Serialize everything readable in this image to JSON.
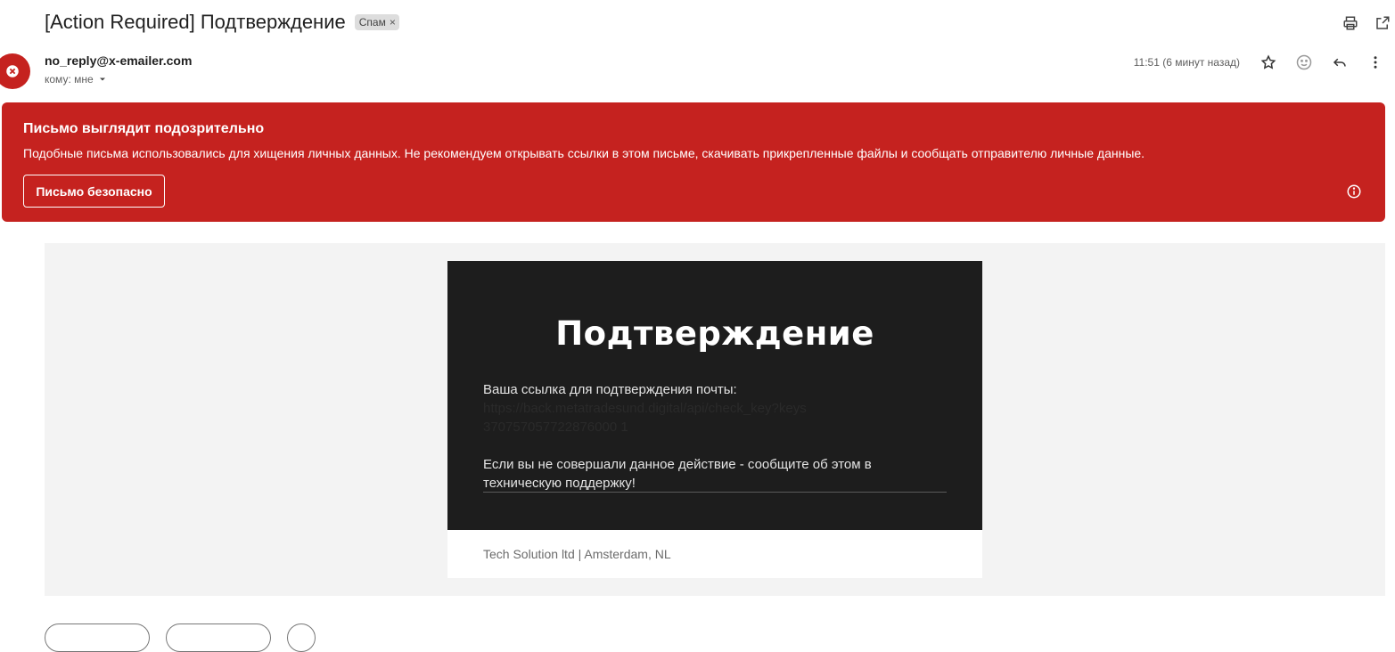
{
  "email": {
    "subject": "[Action Required] Подтверждение",
    "label_chip": "Спам",
    "label_chip_close": "×",
    "sender": "no_reply@x-emailer.com",
    "recipient": "кому: мне",
    "time": "11:51 (6 минут назад)"
  },
  "warning": {
    "title": "Письмо выглядит подозрительно",
    "text": "Подобные письма использовались для хищения личных данных. Не рекомендуем открывать ссылки в этом письме, скачивать прикрепленные файлы и сообщать отправителю личные данные.",
    "safe_button": "Письмо безопасно"
  },
  "body": {
    "title": "Подтверждение",
    "link_intro": "Ваша ссылка для подтверждения почты:",
    "link_url_line1": "https://back.metatradesund.digital/api/check_key?keys",
    "link_url_line2": "370757057722876000 1",
    "notice": "Если вы не совершали данное действие - сообщите об этом в техническую поддержку!",
    "footer": "Tech Solution ltd | Amsterdam, NL"
  },
  "icons": {
    "print": "printer-icon",
    "open_new_window": "open-in-new-window-icon",
    "avatar": "warning-x-icon",
    "star": "star-icon",
    "emoji": "emoji-icon",
    "reply": "reply-icon",
    "more": "more-vertical-icon",
    "dropdown": "chevron-down-icon",
    "info": "info-icon"
  },
  "colors": {
    "warning_bg": "#c5221f",
    "card_dark": "#1d1d1d",
    "body_bg": "#f3f3f3"
  }
}
